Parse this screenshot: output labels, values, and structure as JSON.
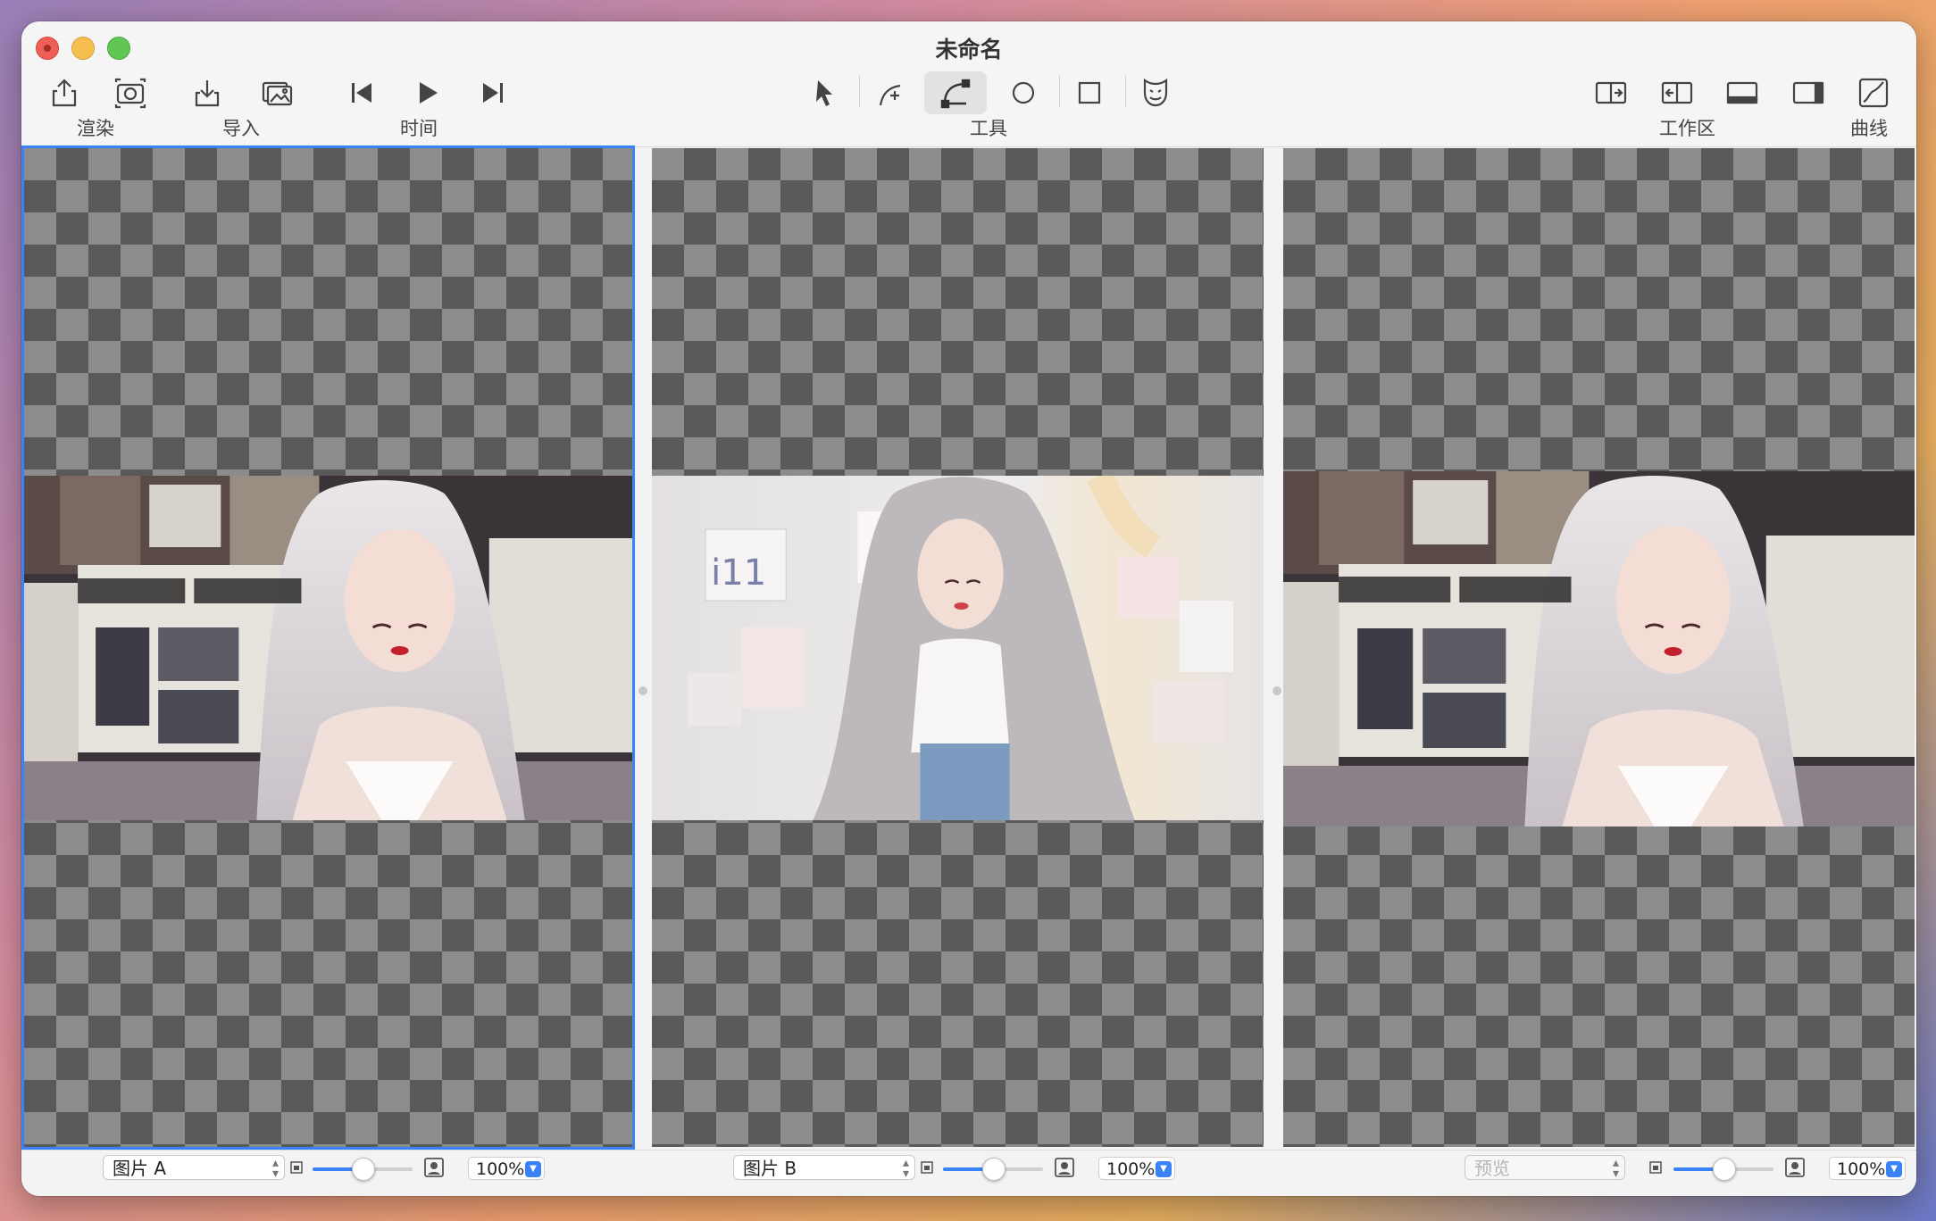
{
  "window": {
    "title": "未命名"
  },
  "toolbar": {
    "groups": {
      "render": "渲染",
      "import": "导入",
      "time": "时间",
      "tools": "工具",
      "workspace": "工作区",
      "curves": "曲线"
    },
    "icons": {
      "left": [
        "share-icon",
        "camera-icon",
        "import-icon",
        "image-icon",
        "skip-back-icon",
        "play-icon",
        "skip-forward-icon"
      ],
      "tools": [
        "pointer-icon",
        "pen-add-icon",
        "bezier-icon",
        "circle-icon",
        "square-icon",
        "face-icon"
      ],
      "right": [
        "split-right-icon",
        "split-left-icon",
        "bottom-panel-icon",
        "right-panel-icon",
        "curve-icon"
      ]
    },
    "active_tool": "bezier-icon"
  },
  "panels": {
    "a": {
      "popup": "图片 A",
      "zoom": "100%",
      "slider_level": 0.5
    },
    "b": {
      "popup": "图片 B",
      "zoom": "100%",
      "slider_level": 0.5
    },
    "preview": {
      "popup": "预览",
      "zoom": "100%",
      "slider_level": 0.5
    }
  },
  "colors": {
    "accent": "#3a82f7",
    "checker_dark": "#595959",
    "checker_light": "#8c8c8c"
  }
}
